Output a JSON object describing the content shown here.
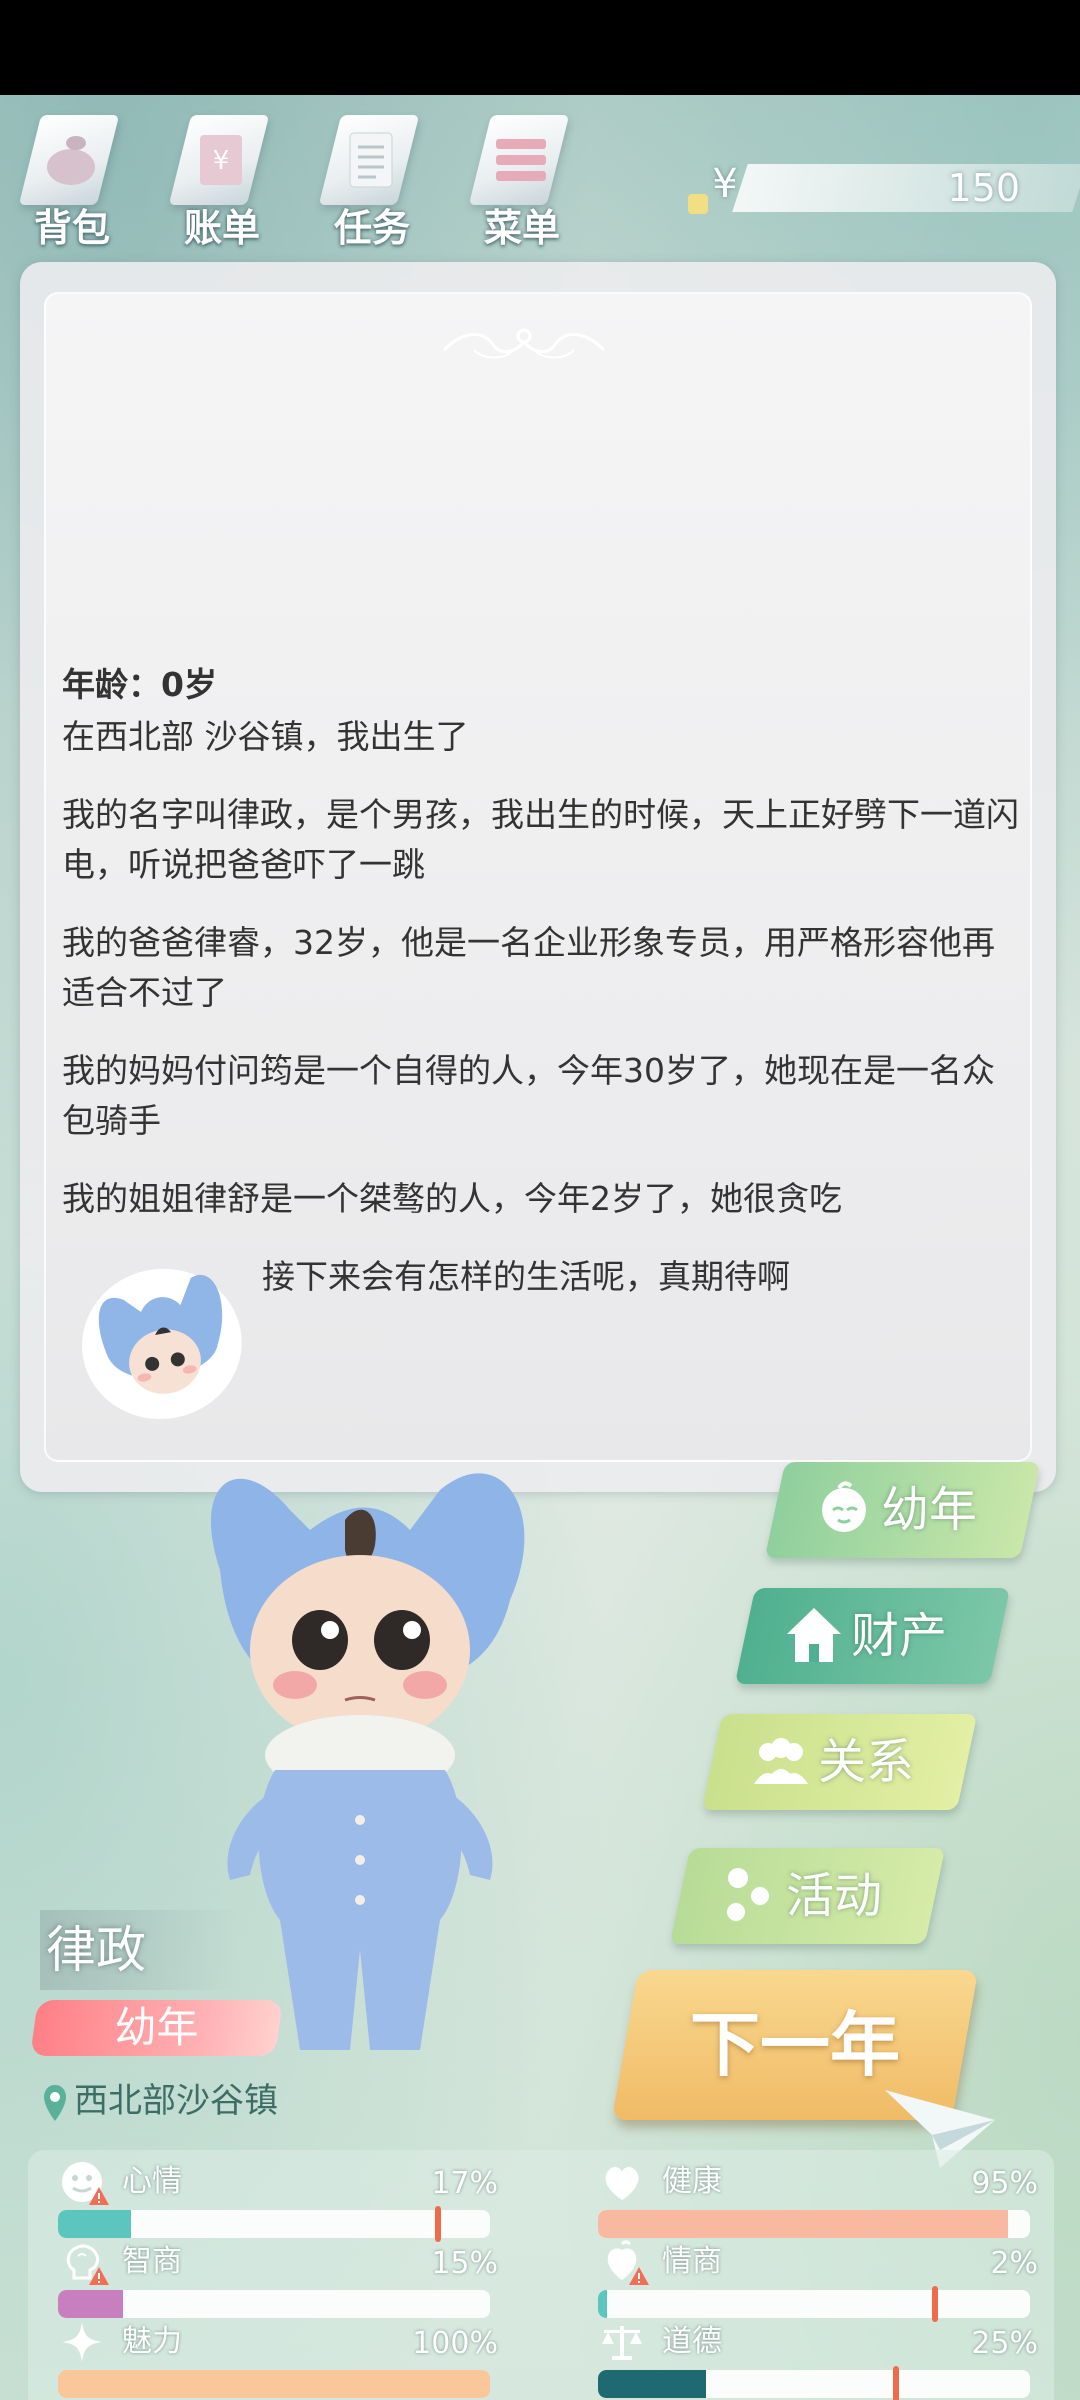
{
  "top_menu": [
    {
      "label": "背包",
      "icon": "bag-icon"
    },
    {
      "label": "账单",
      "icon": "bill-icon"
    },
    {
      "label": "任务",
      "icon": "task-icon"
    },
    {
      "label": "菜单",
      "icon": "menu-icon"
    }
  ],
  "money": {
    "symbol": "¥",
    "amount": "150"
  },
  "story": {
    "age": "年龄：0岁",
    "paragraphs": [
      "在西北部 沙谷镇，我出生了",
      "我的名字叫律政，是个男孩，我出生的时候，天上正好劈下一道闪电，听说把爸爸吓了一跳",
      "我的爸爸律睿，32岁，他是一名企业形象专员，用严格形容他再适合不过了",
      "我的妈妈付问筠是一个自得的人，今年30岁了，她现在是一名众包骑手",
      "我的姐姐律舒是一个桀骜的人，今年2岁了，她很贪吃"
    ],
    "closing": "接下来会有怎样的生活呢，真期待啊"
  },
  "actions": [
    {
      "label": "幼年",
      "icon": "baby-face-icon",
      "color": "#9fd0a6"
    },
    {
      "label": "财产",
      "icon": "house-icon",
      "color": "#5cb59a"
    },
    {
      "label": "关系",
      "icon": "people-icon",
      "color": "#b8d98c"
    },
    {
      "label": "活动",
      "icon": "activity-icon",
      "color": "#a8d39a"
    }
  ],
  "next_year": "下一年",
  "character": {
    "name": "律政",
    "stage": "幼年",
    "location": "西北部沙谷镇"
  },
  "stats": [
    {
      "label": "心情",
      "value": "17%",
      "icon": "smile-icon",
      "warning": true,
      "fill": 0.17,
      "color": "#5cc6bd",
      "marker": 0.88
    },
    {
      "label": "健康",
      "value": "95%",
      "icon": "heart-icon",
      "warning": false,
      "fill": 0.95,
      "color": "#f9b9a0"
    },
    {
      "label": "智商",
      "value": "15%",
      "icon": "brain-icon",
      "warning": true,
      "fill": 0.15,
      "color": "#c77fbf"
    },
    {
      "label": "情商",
      "value": "2%",
      "icon": "emotion-icon",
      "warning": true,
      "fill": 0.02,
      "color": "#5cc6bd",
      "marker": 0.78
    },
    {
      "label": "魅力",
      "value": "100%",
      "icon": "sparkle-icon",
      "warning": false,
      "fill": 1.0,
      "color": "#f9c79a"
    },
    {
      "label": "道德",
      "value": "25%",
      "icon": "scale-icon",
      "warning": false,
      "fill": 0.25,
      "color": "#1f6a72",
      "marker": 0.69
    }
  ]
}
